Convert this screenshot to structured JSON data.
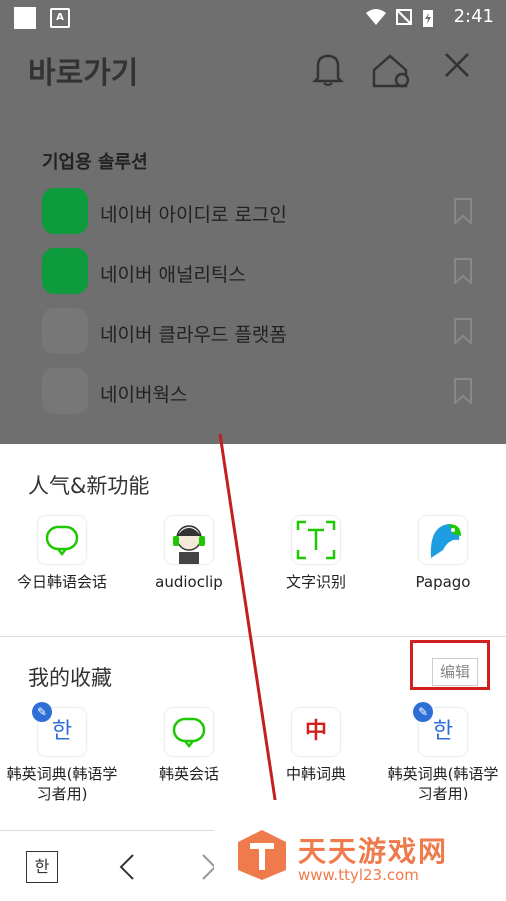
{
  "status_bar": {
    "time": "2:41"
  },
  "top_bar": {
    "title": "바로가기"
  },
  "panel": {
    "heading": "기업용 솔루션",
    "items": [
      {
        "label": "네이버 아이디로 로그인",
        "icon": "naver-id-login-icon"
      },
      {
        "label": "네이버 애널리틱스",
        "icon": "naver-analytics-icon"
      },
      {
        "label": "네이버 클라우드 플랫폼",
        "icon": "naver-cloud-platform-icon"
      },
      {
        "label": "네이버웍스",
        "icon": "naver-works-icon"
      }
    ]
  },
  "popular": {
    "title": "人气&新功能",
    "apps": [
      {
        "label": "今日韩语会话",
        "icon": "speech-bubble-icon"
      },
      {
        "label": "audioclip",
        "icon": "audioclip-avatar-icon"
      },
      {
        "label": "文字识别",
        "icon": "text-recognition-icon"
      },
      {
        "label": "Papago",
        "icon": "papago-parrot-icon"
      }
    ]
  },
  "favorites": {
    "title": "我的收藏",
    "edit_label": "编辑",
    "apps": [
      {
        "label": "韩英词典(韩语学习者用)",
        "icon": "han-dictionary-icon",
        "glyph": "한"
      },
      {
        "label": "韩英会话",
        "icon": "speech-bubble-icon"
      },
      {
        "label": "中韩词典",
        "icon": "chinese-dictionary-icon",
        "glyph": "中"
      },
      {
        "label": "韩英词典(韩语学习者用)",
        "icon": "han-dictionary-icon",
        "glyph": "한"
      }
    ]
  },
  "nav": {
    "han_label": "한"
  },
  "watermark": {
    "name": "天天游戏网",
    "url": "www.ttyl23.com"
  },
  "colors": {
    "naver_green": "#1ec800",
    "highlight_red": "#d02020",
    "watermark_orange": "#ef7a4b"
  }
}
